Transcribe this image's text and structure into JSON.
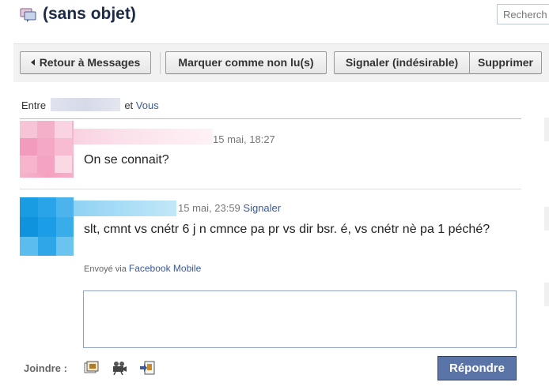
{
  "header": {
    "title": "(sans objet)",
    "search_placeholder": "Recherch",
    "icon": "messages-icon"
  },
  "toolbar": {
    "back_label": "Retour à Messages",
    "mark_unread_label": "Marquer comme non lu(s)",
    "report_spam_label": "Signaler (indésirable)",
    "delete_label": "Supprimer"
  },
  "participants": {
    "prefix": "Entre",
    "and": "et",
    "you": "Vous"
  },
  "messages": [
    {
      "time": "15 mai, 18:27",
      "text": "On se connait?"
    },
    {
      "time": "15 mai, 23:59",
      "report": "Signaler",
      "text": "slt, cmnt vs cnétr 6 j n cmnce pa pr vs dir bsr. é, vs cnétr nè pa 1 péché?",
      "sent_via_prefix": "Envoyé via",
      "sent_via_app": "Facebook Mobile"
    }
  ],
  "reply": {
    "attach_label": "Joindre :",
    "attach_icons": [
      "photo-icon",
      "video-icon",
      "share-link-icon"
    ],
    "send_label": "Répondre"
  },
  "colors": {
    "link": "#3b5998",
    "button_primary": "#5b74a8",
    "title": "#1c2a47"
  }
}
